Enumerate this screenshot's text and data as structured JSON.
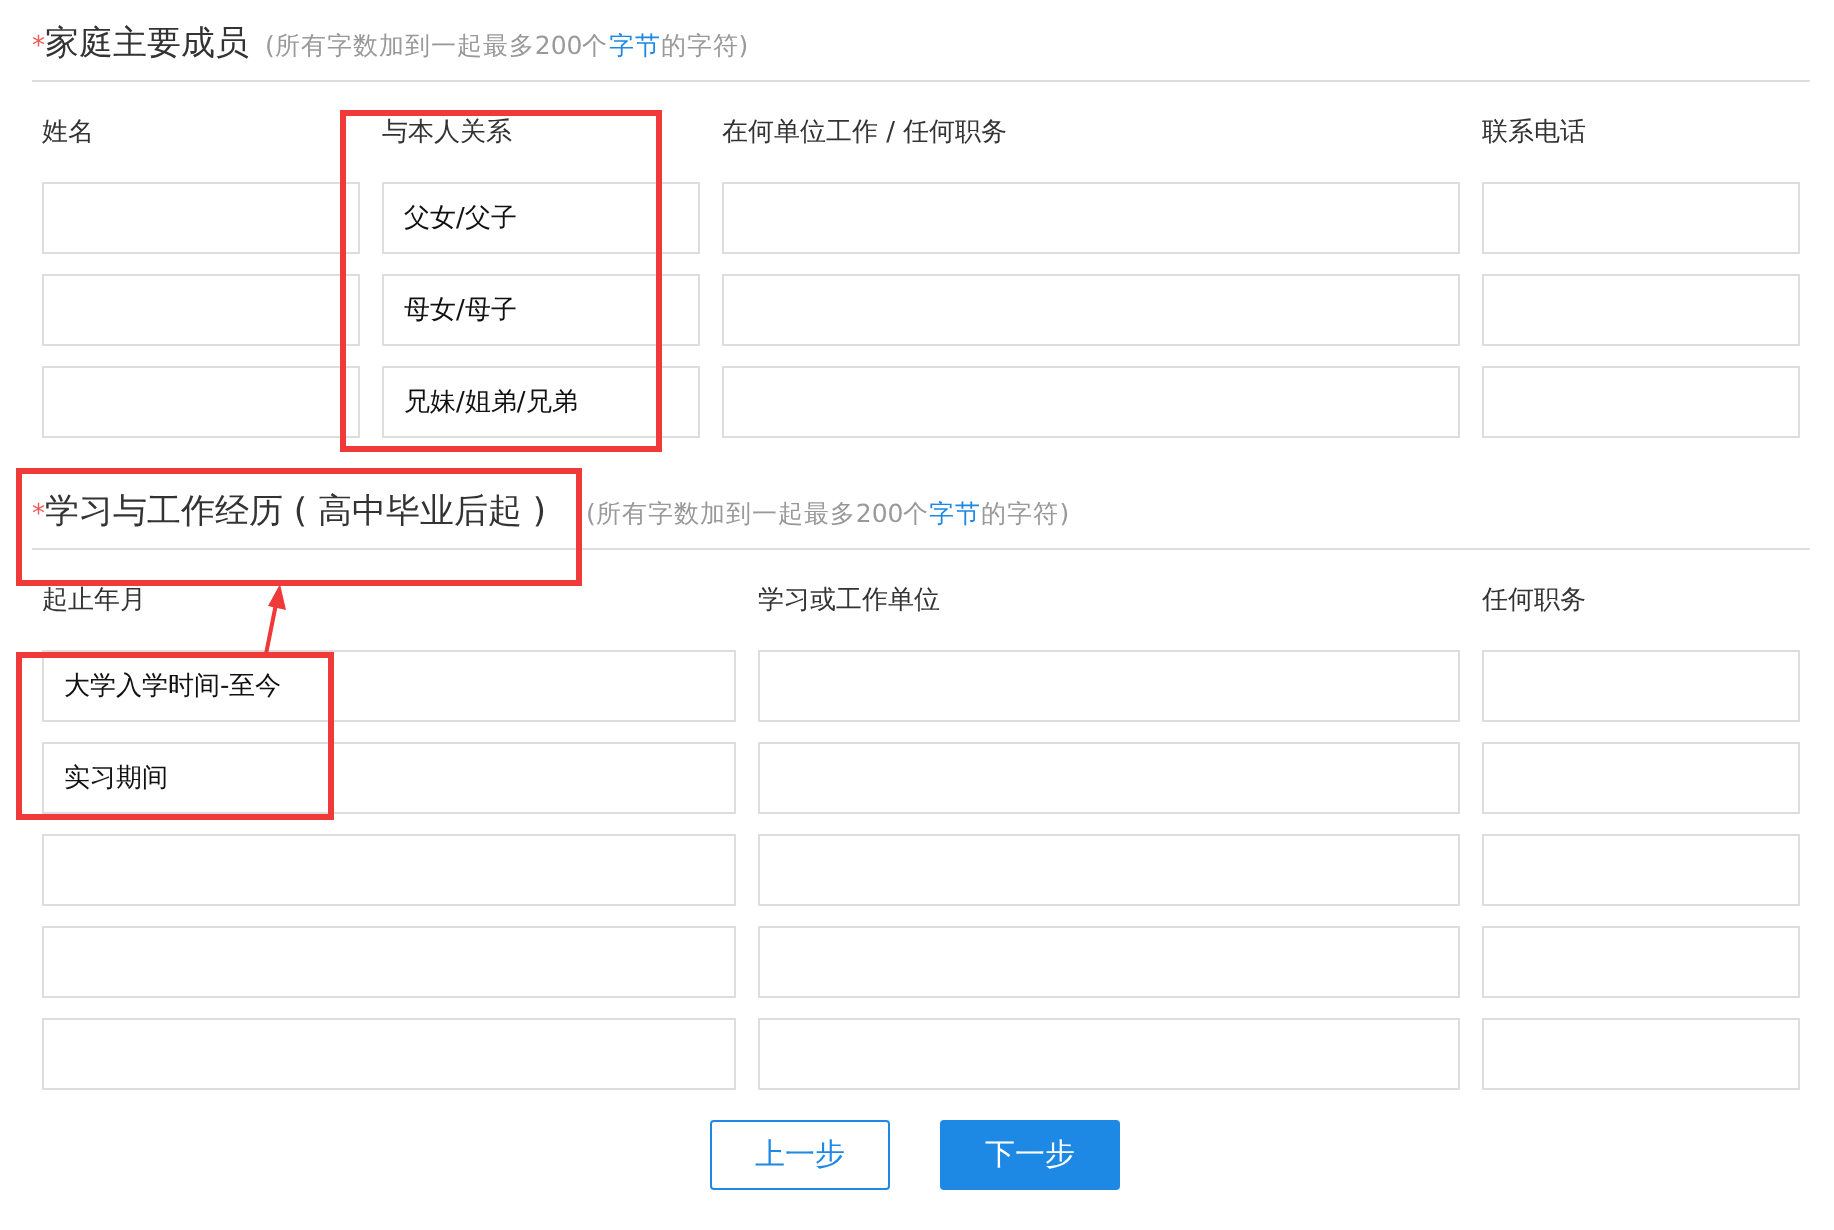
{
  "sections": [
    {
      "required_mark": "*",
      "title": "家庭主要成员",
      "note_before": "(所有字数加到一起最多200个",
      "note_link": "字节",
      "note_after": "的字符)",
      "columns": [
        "姓名",
        "与本人关系",
        "在何单位工作 / 任何职务",
        "联系电话"
      ],
      "rows": [
        [
          "",
          "父女/父子",
          "",
          ""
        ],
        [
          "",
          "母女/母子",
          "",
          ""
        ],
        [
          "",
          "兄妹/姐弟/兄弟",
          "",
          ""
        ]
      ]
    },
    {
      "required_mark": "*",
      "title": "学习与工作经历 ( 高中毕业后起 )",
      "note_before": "(所有字数加到一起最多200个",
      "note_link": "字节",
      "note_after": "的字符)",
      "columns": [
        "起止年月",
        "学习或工作单位",
        "任何职务"
      ],
      "rows": [
        [
          "大学入学时间-至今",
          "",
          ""
        ],
        [
          "实习期间",
          "",
          ""
        ],
        [
          "",
          "",
          ""
        ],
        [
          "",
          "",
          ""
        ],
        [
          "",
          "",
          ""
        ]
      ]
    }
  ],
  "buttons": [
    {
      "label": "上一步",
      "kind": "secondary"
    },
    {
      "label": "下一步",
      "kind": "primary"
    }
  ]
}
